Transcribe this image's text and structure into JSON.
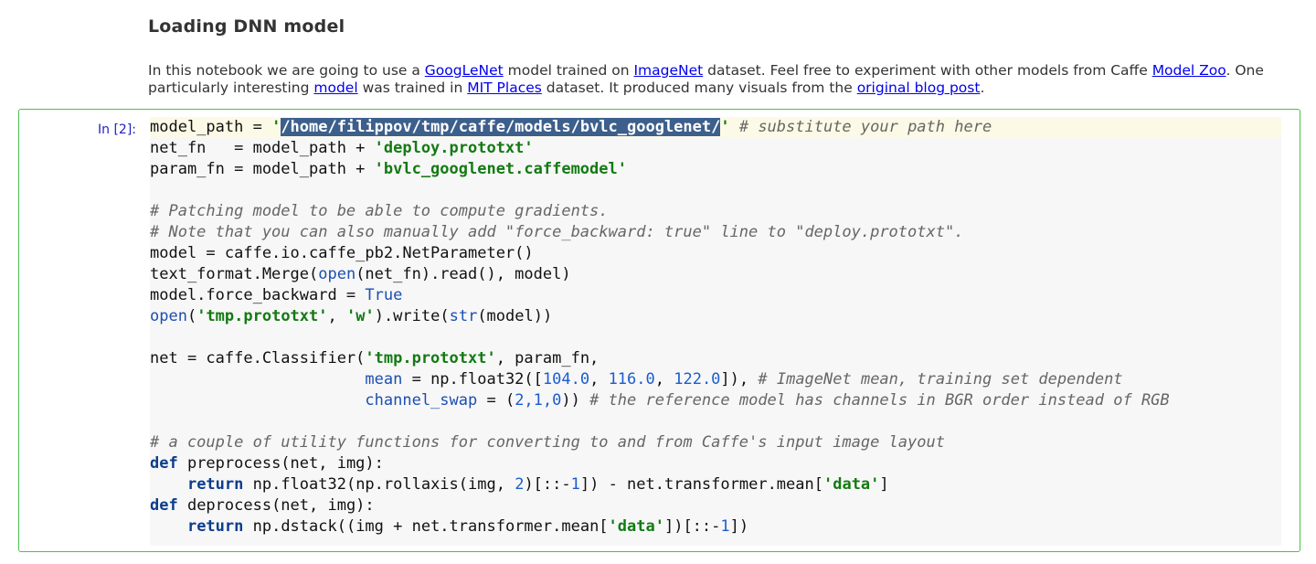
{
  "heading": "Loading DNN model",
  "intro": {
    "t1": "In this notebook we are going to use a ",
    "link_googlenet": "GoogLeNet",
    "t2": " model trained on ",
    "link_imagenet": "ImageNet",
    "t3": " dataset. Feel free to experiment with other models from Caffe ",
    "link_modelzoo": "Model Zoo",
    "t4": ". One particularly interesting ",
    "link_model": "model",
    "t5": " was trained in ",
    "link_mitplaces": "MIT Places",
    "t6": " dataset. It produced many visuals from the ",
    "link_blogpost": "original blog post",
    "t7": "."
  },
  "cell": {
    "prompt": "In [2]:",
    "code": {
      "l1_a": "model_path = ",
      "l1_q1": "'",
      "l1_sel": "/home/filippov/tmp/caffe/models/bvlc_googlenet/",
      "l1_q2": "'",
      "l1_c": " # substitute your path here",
      "l2_a": "net_fn   = model_path + ",
      "l2_s": "'deploy.prototxt'",
      "l3_a": "param_fn = model_path + ",
      "l3_s": "'bvlc_googlenet.caffemodel'",
      "l5": "# Patching model to be able to compute gradients.",
      "l6": "# Note that you can also manually add \"force_backward: true\" line to \"deploy.prototxt\".",
      "l7": "model = caffe.io.caffe_pb2.NetParameter()",
      "l8_a": "text_format.Merge(",
      "l8_open": "open",
      "l8_b": "(net_fn).read(), model)",
      "l9_a": "model.force_backward = ",
      "l9_true": "True",
      "l10_open": "open",
      "l10_a": "(",
      "l10_s1": "'tmp.prototxt'",
      "l10_b": ", ",
      "l10_s2": "'w'",
      "l10_c": ").write(",
      "l10_str": "str",
      "l10_d": "(model))",
      "l12_a": "net = caffe.Classifier(",
      "l12_s": "'tmp.prototxt'",
      "l12_b": ", param_fn,",
      "l13_indent": "                       ",
      "l13_kw": "mean",
      "l13_a": " = np.float32([",
      "l13_n1": "104.0",
      "l13_b": ", ",
      "l13_n2": "116.0",
      "l13_c": ", ",
      "l13_n3": "122.0",
      "l13_d": "]), ",
      "l13_cm": "# ImageNet mean, training set dependent",
      "l14_indent": "                       ",
      "l14_kw": "channel_swap",
      "l14_a": " = (",
      "l14_n": "2,1,0",
      "l14_b": ")) ",
      "l14_cm": "# the reference model has channels in BGR order instead of RGB",
      "l16": "# a couple of utility functions for converting to and from Caffe's input image layout",
      "l17_def": "def",
      "l17_a": " preprocess(net, img):",
      "l18_indent": "    ",
      "l18_ret": "return",
      "l18_a": " np.float32(np.rollaxis(img, ",
      "l18_n": "2",
      "l18_b": ")[::-",
      "l18_n2": "1",
      "l18_c": "]) - net.transformer.mean[",
      "l18_s": "'data'",
      "l18_d": "]",
      "l19_def": "def",
      "l19_a": " deprocess(net, img):",
      "l20_indent": "    ",
      "l20_ret": "return",
      "l20_a": " np.dstack((img + net.transformer.mean[",
      "l20_s": "'data'",
      "l20_b": "])[::-",
      "l20_n": "1",
      "l20_c": "])"
    }
  },
  "colors": {
    "cell_border": "#4bc24b",
    "prompt": "#2323c0",
    "link": "#0000ee",
    "selection": "#3c5f8c"
  }
}
